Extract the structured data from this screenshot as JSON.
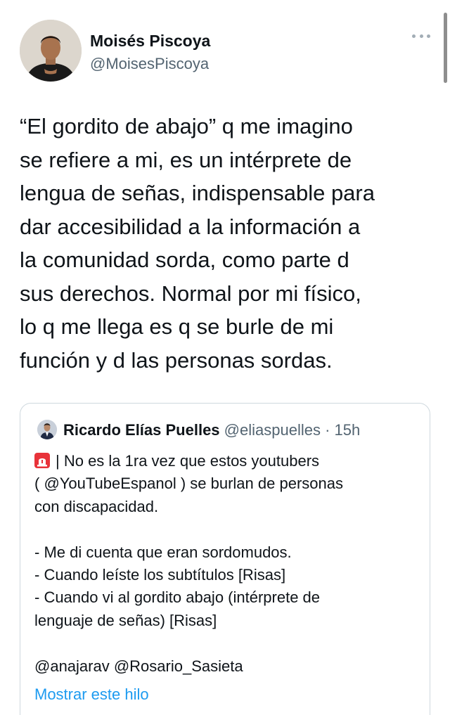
{
  "author": {
    "display_name": "Moisés Piscoya",
    "username": "@MoisesPiscoya",
    "avatar": "profile-photo"
  },
  "tweet": {
    "lines": [
      "“El gordito de abajo” q me imagino",
      "se refiere a mi, es un intérprete de",
      "lengua de señas, indispensable para",
      "dar accesibilidad a la información a",
      "la comunidad sorda, como parte d",
      "sus derechos. Normal por mi físico,",
      "lo q me llega es q se burle de mi",
      "función y d las personas sordas."
    ]
  },
  "quoted_tweet": {
    "display_name": "Ricardo Elías Puelles",
    "username": "@eliaspuelles",
    "separator": "·",
    "time": "15h",
    "icon": "rotating-light-emoji",
    "lines": [
      "| No es la 1ra vez que estos youtubers",
      "( @YouTubeEspanol ) se burlan de personas",
      "con discapacidad.",
      "",
      "- Me di cuenta que eran sordomudos.",
      "- Cuando leíste los subtítulos [Risas]",
      "- Cuando vi al gordito abajo (intérprete de",
      "lenguaje de señas) [Risas]",
      "",
      "@anajarav @Rosario_Sasieta"
    ],
    "show_thread": "Mostrar este hilo"
  },
  "colors": {
    "text_primary": "#0f1419",
    "text_secondary": "#536471",
    "link": "#1d9bf0",
    "border": "#cfd9de"
  }
}
